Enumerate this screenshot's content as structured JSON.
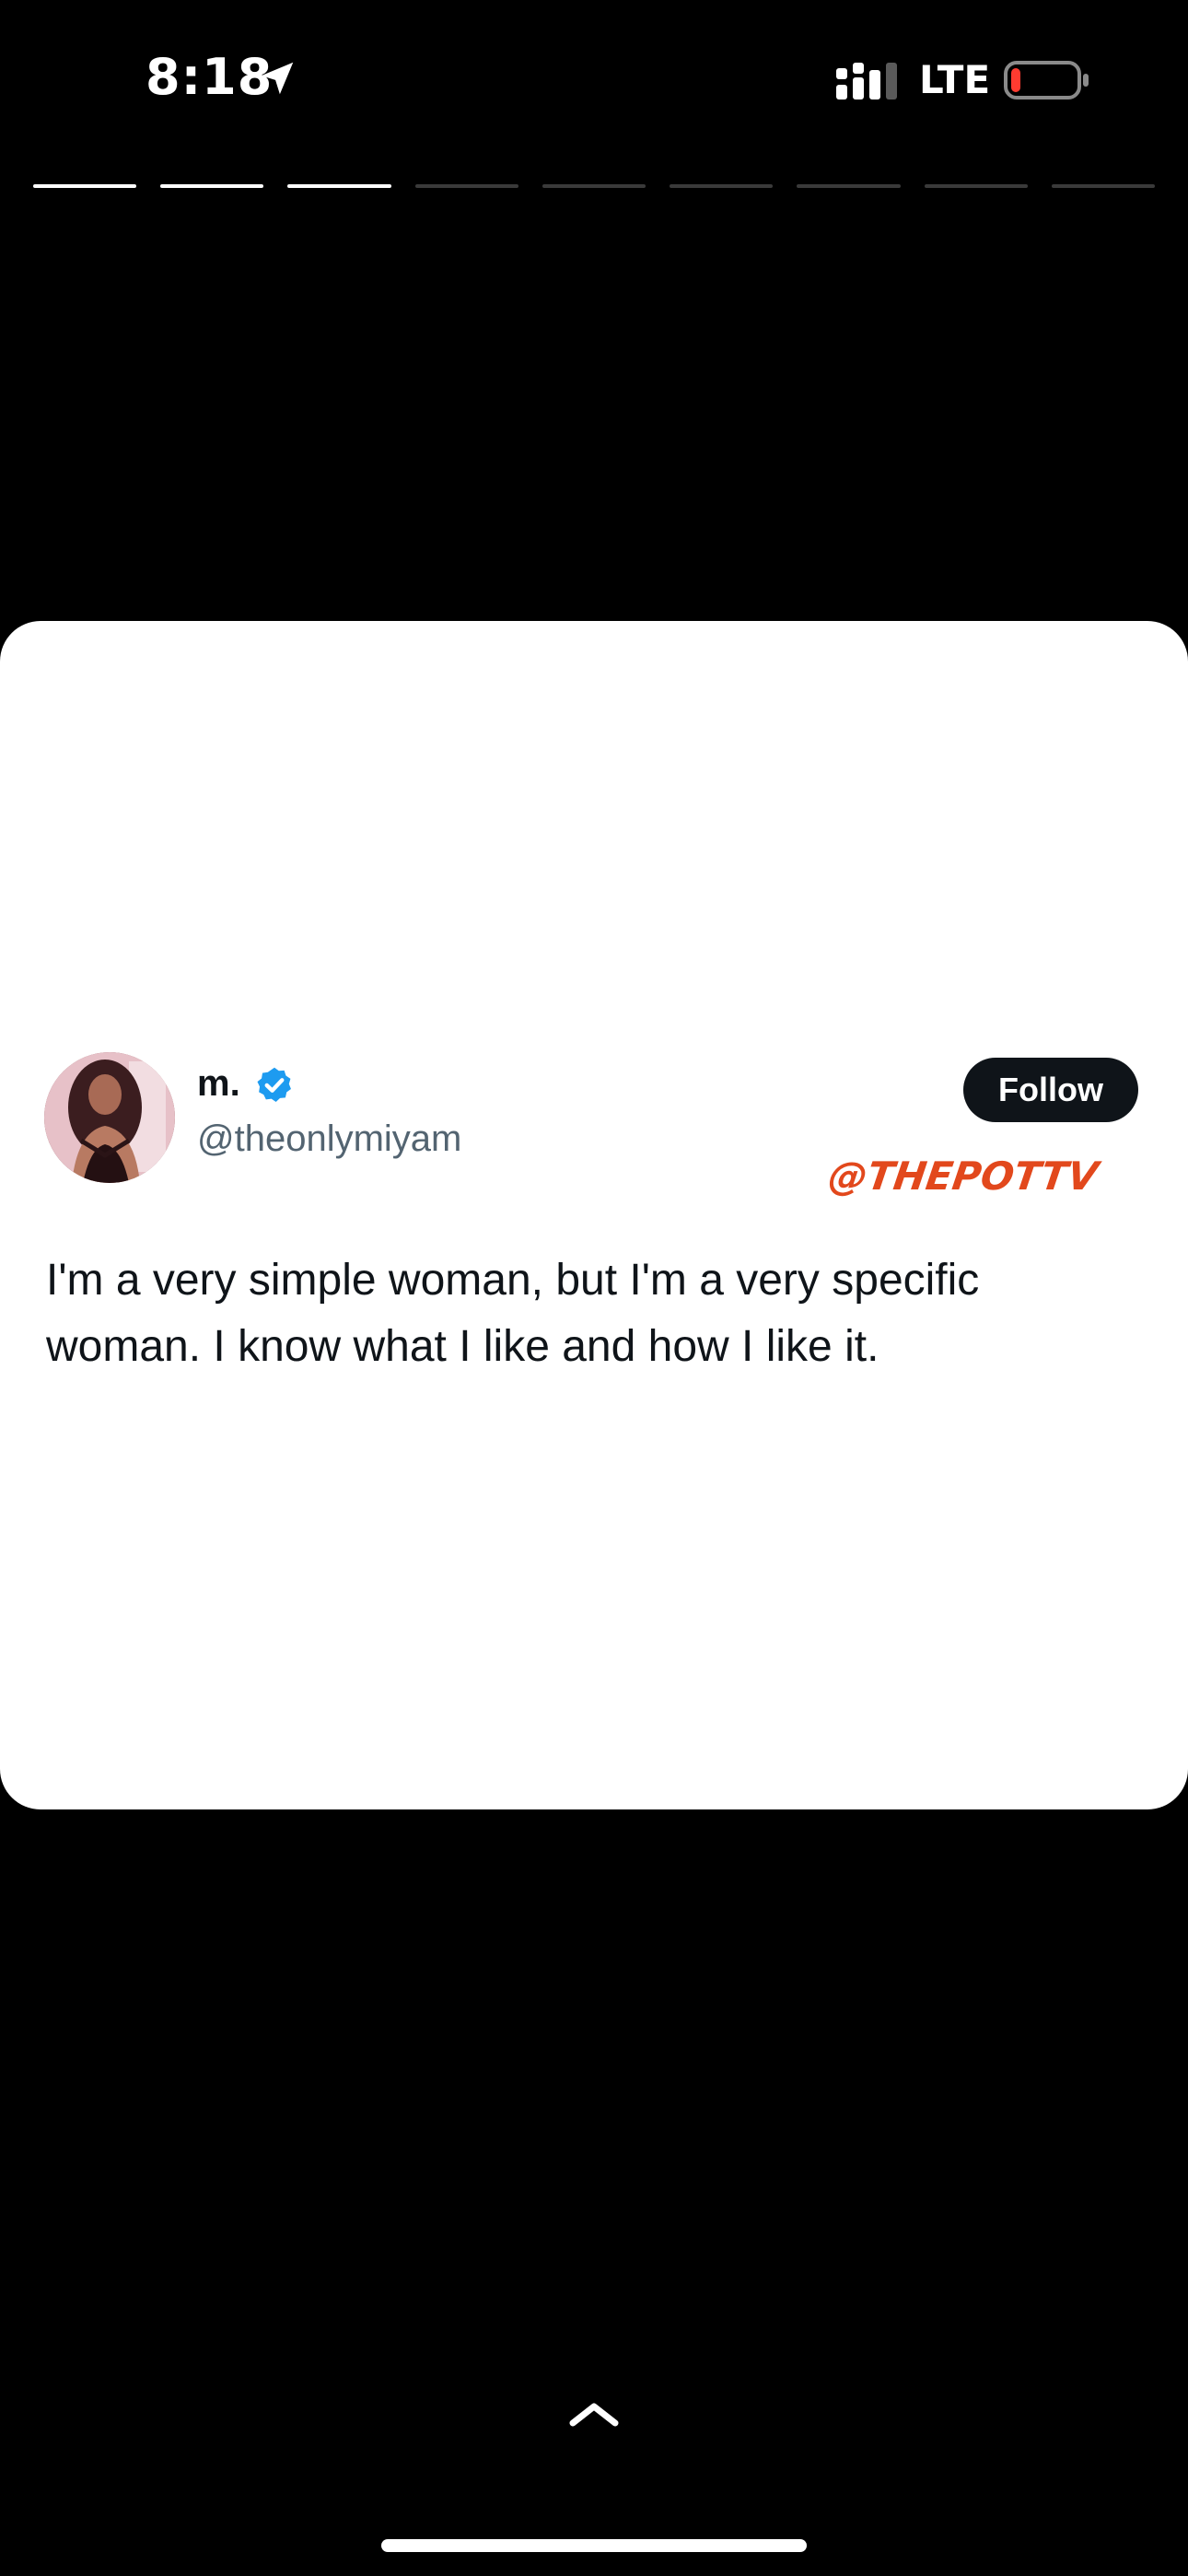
{
  "status_bar": {
    "time": "8:18",
    "network": "LTE",
    "battery_color": "#ff3b30",
    "icons": [
      "location-arrow-icon",
      "signal-icon",
      "battery-icon"
    ]
  },
  "story": {
    "segments_total": 9,
    "segments_viewed": 3
  },
  "tweet": {
    "display_name": "m.",
    "verified": true,
    "verified_color": "#1d9bf0",
    "handle": "@theonlymiyam",
    "follow_label": "Follow",
    "watermark": "@THEPOTTV",
    "text": "I'm a very simple woman, but I'm a very specific woman. I know what I like and how I like it."
  },
  "bottom": {
    "icons": [
      "chevron-up-icon"
    ]
  }
}
